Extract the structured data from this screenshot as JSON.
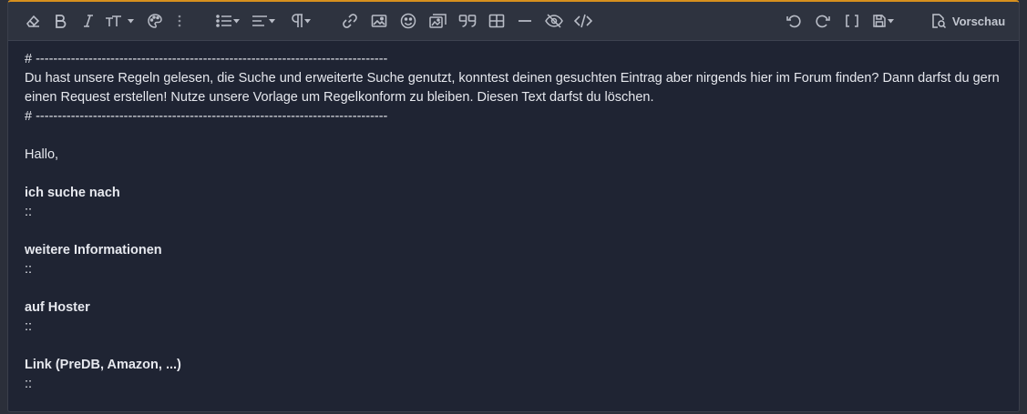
{
  "toolbar": {
    "left_icons": [
      "eraser-icon",
      "bold-icon",
      "italic-icon",
      "text-size-icon",
      "palette-icon",
      "more-vertical-icon",
      "list-icon",
      "align-icon",
      "paragraph-icon",
      "link-icon",
      "image-icon",
      "smiley-icon",
      "media-icon",
      "quote-icon",
      "table-icon",
      "horizontal-rule-icon",
      "spoiler-hide-icon",
      "code-icon"
    ],
    "right_icons": [
      "undo-icon",
      "redo-icon",
      "bbcode-toggle-icon",
      "save-draft-icon",
      "preview-icon"
    ],
    "preview_label": "Vorschau",
    "accent_color": "#d7901e"
  },
  "content": {
    "separator_top": "# --------------------------------------------------------------------------------",
    "intro": "Du hast unsere Regeln gelesen, die Suche und erweiterte Suche  genutzt, konntest deinen gesuchten Eintrag aber nirgends hier im Forum finden? Dann darfst du gern einen Request erstellen! Nutze unsere Vorlage um Regelkonform zu bleiben. Diesen Text darfst du löschen.",
    "separator_bottom": "# --------------------------------------------------------------------------------",
    "greeting": "Hallo,",
    "section1_heading": "ich suche nach",
    "section1_value": "::",
    "section2_heading": "weitere Informationen",
    "section2_value": "::",
    "section3_heading": "auf Hoster",
    "section3_value": "::",
    "section4_heading": "Link (PreDB, Amazon, ...)",
    "section4_value": "::"
  }
}
